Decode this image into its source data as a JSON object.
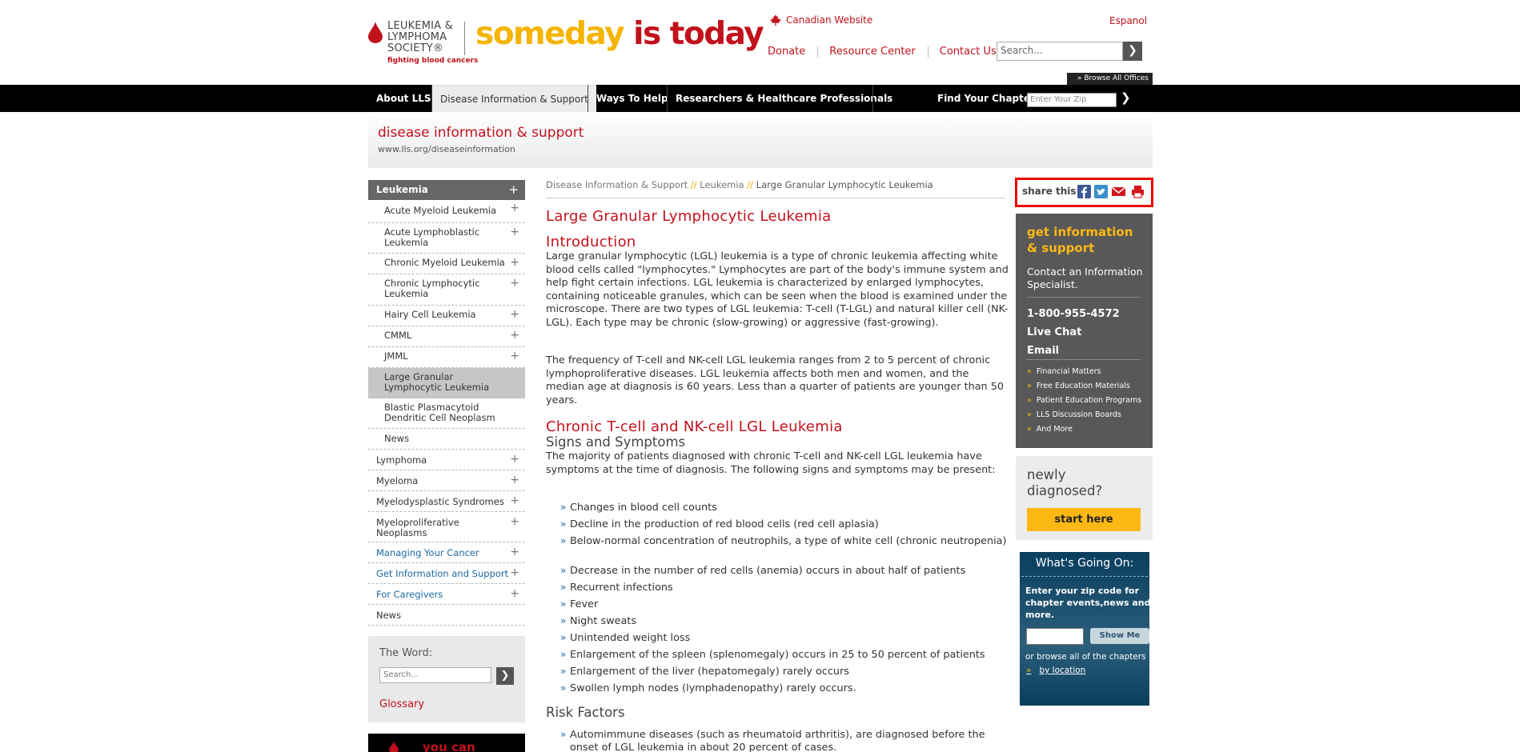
{
  "header": {
    "logo_text": "LEUKEMIA & LYMPHOMA SOCIETY®",
    "logo_tagline": "fighting blood cancers",
    "tagline_part1": "someday",
    "tagline_part2": "is today",
    "canadian_link": "Canadian Website",
    "espanol_link": "Espanol",
    "top_links": [
      "Donate",
      "Resource Center",
      "Contact Us"
    ],
    "search_placeholder": "Search...",
    "browse_offices": "» Browse All Offices"
  },
  "nav": {
    "items": [
      "About LLS",
      "Disease Information & Support",
      "Ways To Help",
      "Researchers & Healthcare Professionals"
    ],
    "find_chapter": "Find Your Chapter",
    "zip_placeholder": "Enter Your Zip"
  },
  "banner": {
    "title": "disease information & support",
    "url": "www.lls.org/diseaseinformation"
  },
  "sidebar": {
    "header": "Leukemia",
    "items": [
      {
        "label": "Acute Myeloid Leukemia",
        "plus": "+"
      },
      {
        "label": "Acute Lymphoblastic Leukemia",
        "plus": "+"
      },
      {
        "label": "Chronic Myeloid Leukemia",
        "plus": "+"
      },
      {
        "label": "Chronic Lymphocytic Leukemia",
        "plus": "+"
      },
      {
        "label": "Hairy Cell Leukemia",
        "plus": "+"
      },
      {
        "label": "CMML",
        "plus": "+"
      },
      {
        "label": "JMML",
        "plus": "+"
      },
      {
        "label": "Large Granular Lymphocytic Leukemia",
        "plus": ""
      },
      {
        "label": "Blastic Plasmacytoid Dendritic Cell Neoplasm",
        "plus": ""
      },
      {
        "label": "News",
        "plus": ""
      }
    ],
    "top_items": [
      {
        "label": "Lymphoma",
        "plus": "+"
      },
      {
        "label": "Myeloma",
        "plus": "+"
      },
      {
        "label": "Myelodysplastic Syndromes",
        "plus": "+"
      },
      {
        "label": "Myeloproliferative Neoplasms",
        "plus": "+"
      },
      {
        "label": "Managing Your Cancer",
        "plus": "+"
      },
      {
        "label": "Get Information and Support",
        "plus": "+"
      },
      {
        "label": "For Caregivers",
        "plus": "+"
      },
      {
        "label": "News",
        "plus": ""
      }
    ],
    "word_title": "The Word:",
    "word_placeholder": "Search...",
    "glossary": "Glossary",
    "ad_text": "you can"
  },
  "content": {
    "breadcrumb": [
      "Disease Information & Support",
      "Leukemia",
      "Large Granular Lymphocytic Leukemia"
    ],
    "breadcrumb_sep": "//",
    "title": "Large Granular Lymphocytic Leukemia",
    "intro_heading": "Introduction",
    "intro_p1": "Large granular lymphocytic (LGL) leukemia is a type of chronic leukemia affecting white blood cells called \"lymphocytes.\"  Lymphocytes are part of the body's immune system and help fight certain infections. LGL leukemia is characterized by enlarged lymphocytes, containing noticeable granules, which can be seen when the blood is examined under the microscope. There are two types of LGL leukemia: T-cell (T-LGL) and natural killer cell (NK-LGL). Each type may be chronic (slow-growing) or aggressive (fast-growing).",
    "intro_p2": "The frequency of T-cell and NK-cell LGL leukemia ranges from 2 to 5 percent of chronic lymphoproliferative diseases. LGL leukemia affects both men and women, and the median age at diagnosis is 60 years.  Less than a quarter of patients are younger than 50 years.",
    "chronic_heading": "Chronic T-cell and NK-cell LGL Leukemia",
    "signs_heading": "Signs and Symptoms",
    "signs_intro": "The majority of patients diagnosed with chronic T-cell and NK-cell LGL leukemia have symptoms at the time of diagnosis. The following signs and symptoms may be present:",
    "bullet_marker": "»",
    "symptoms": [
      "Changes in blood cell counts",
      "Decline in the production of red blood cells (red cell aplasia)",
      "Below-normal concentration of neutrophils, a type of white cell (chronic neutropenia)",
      "Decrease in the number of red cells (anemia) occurs in about half of patients",
      "Recurrent infections",
      "Fever",
      "Night sweats",
      "Unintended weight loss",
      "Enlargement of the spleen (splenomegaly) occurs in 25 to 50 percent of patients",
      "Enlargement of the liver (hepatomegaly) rarely occurs",
      "Swollen lymph nodes (lymphadenopathy) rarely occurs."
    ],
    "risk_heading": "Risk Factors",
    "risk_items": [
      "Automimmune diseases (such as rheumatoid arthritis), are diagnosed before the onset of LGL leukemia in about 20 percent of cases."
    ]
  },
  "right": {
    "share_label": "share this",
    "get_info_title": "get information & support",
    "contact_text": "Contact an Information Specialist.",
    "phone": "1-800-955-4572",
    "live_chat": "Live Chat",
    "email": "Email",
    "links": [
      "Financial Matters",
      "Free Education Materials",
      "Patient Education Programs",
      "LLS Discussion Boards",
      "And More"
    ],
    "newly_diagnosed": "newly diagnosed?",
    "start_here": "start here",
    "going_title": "What's Going On:",
    "going_text": "Enter your zip code for chapter events,news and more.",
    "show_me": "Show Me",
    "browse_text": "or browse all of the chapters",
    "by_location": "by location"
  },
  "colors": {
    "brand_red": "#c1121c",
    "brand_yellow": "#fdb813",
    "link_blue": "#1c6aa3",
    "nav_black": "#000000"
  }
}
